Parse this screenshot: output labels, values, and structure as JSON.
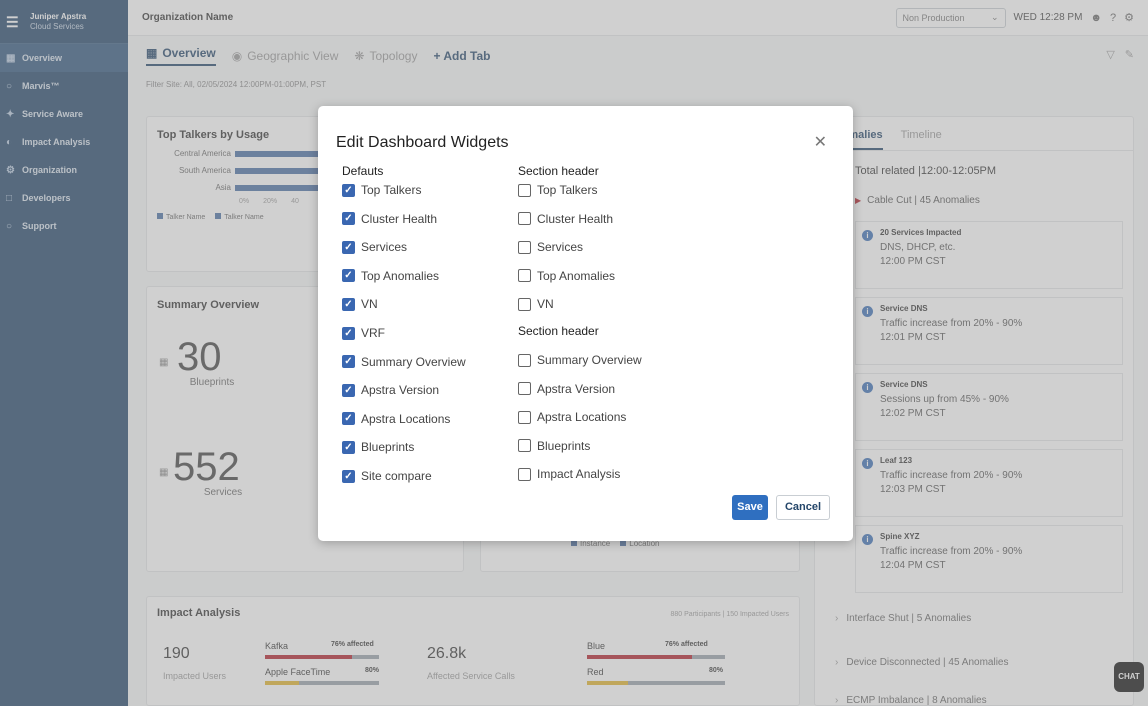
{
  "app": {
    "brand_line1": "Juniper Apstra",
    "brand_line2": "Cloud Services",
    "org_name": "Organization Name",
    "environment": "Non Production",
    "clock": "WED 12:28 PM"
  },
  "sidebar": {
    "items": [
      {
        "label": "Overview",
        "icon": "grid-icon"
      },
      {
        "label": "Marvis™",
        "icon": "marvis-icon"
      },
      {
        "label": "Service Aware",
        "icon": "service-icon"
      },
      {
        "label": "Impact Analysis",
        "icon": "impact-icon"
      },
      {
        "label": "Organization",
        "icon": "gear-icon"
      },
      {
        "label": "Developers",
        "icon": "code-icon"
      },
      {
        "label": "Support",
        "icon": "support-icon"
      }
    ]
  },
  "tabs": {
    "overview": "Overview",
    "geographic": "Geographic View",
    "topology": "Topology",
    "add": "+ Add Tab"
  },
  "filter_line": "Filter Site: All, 02/05/2024 12:00PM-01:00PM, PST",
  "talkers": {
    "title": "Top Talkers by Usage",
    "rows": [
      "Central America",
      "South America",
      "Asia"
    ],
    "ticks": [
      "0%",
      "20%",
      "40"
    ],
    "legend": [
      "Talker Name",
      "Talker Name"
    ]
  },
  "summary": {
    "title": "Summary Overview",
    "stat1_value": "30",
    "stat1_label": "Blueprints",
    "stat2_value": "552",
    "stat2_label": "Services"
  },
  "location_legend": [
    "Instance",
    "Location"
  ],
  "impact": {
    "title": "Impact Analysis",
    "meta": "880 Participants | 150 Impacted Users",
    "users_value": "190",
    "users_label": "Impacted Users",
    "calls_value": "26.8k",
    "calls_label": "Affected Service Calls",
    "bars": [
      {
        "name": "Kafka",
        "pct": "76% affected",
        "fill": 0.76
      },
      {
        "name": "Apple FaceTime",
        "pct": "80%",
        "fill": 0.3
      },
      {
        "name": "Blue",
        "pct": "76% affected",
        "fill": 0.76
      },
      {
        "name": "Red",
        "pct": "80%",
        "fill": 0.3
      }
    ]
  },
  "anomalies": {
    "tab_active": "Anomalies",
    "tab_other": "Timeline",
    "total": "Total related |12:00-12:05PM",
    "group": "Cable Cut | 45 Anomalies",
    "items": [
      {
        "title": "20 Services Impacted",
        "desc": "DNS, DHCP, etc.",
        "time": "12:00 PM CST"
      },
      {
        "title": "Service DNS",
        "desc": "Traffic increase from 20% - 90%",
        "time": "12:01 PM CST"
      },
      {
        "title": "Service DNS",
        "desc": "Sessions up from 45% - 90%",
        "time": "12:02 PM CST"
      },
      {
        "title": "Leaf 123",
        "desc": "Traffic increase from 20% - 90%",
        "time": "12:03 PM CST"
      },
      {
        "title": "Spine XYZ",
        "desc": "Traffic increase from 20% - 90%",
        "time": "12:04 PM CST"
      }
    ],
    "collapsed": [
      "Interface Shut | 5 Anomalies",
      "Device Disconnected | 45 Anomalies",
      "ECMP Imbalance | 8 Anomalies"
    ]
  },
  "modal": {
    "title": "Edit Dashboard Widgets",
    "col1_header": "Defauts",
    "col1_items": [
      {
        "label": "Top Talkers",
        "checked": true
      },
      {
        "label": "Cluster Health",
        "checked": true
      },
      {
        "label": "Services",
        "checked": true
      },
      {
        "label": "Top Anomalies",
        "checked": true
      },
      {
        "label": "VN",
        "checked": true
      },
      {
        "label": "VRF",
        "checked": true
      },
      {
        "label": "Summary Overview",
        "checked": true
      },
      {
        "label": "Apstra Version",
        "checked": true
      },
      {
        "label": "Apstra Locations",
        "checked": true
      },
      {
        "label": "Blueprints",
        "checked": true
      },
      {
        "label": "Site compare",
        "checked": true
      }
    ],
    "col2_header": "Section header",
    "col2_items": [
      {
        "label": "Top Talkers",
        "checked": false
      },
      {
        "label": "Cluster Health",
        "checked": false
      },
      {
        "label": "Services",
        "checked": false
      },
      {
        "label": "Top Anomalies",
        "checked": false
      },
      {
        "label": "VN",
        "checked": false
      }
    ],
    "col2b_header": "Section header",
    "col2b_items": [
      {
        "label": "Summary Overview",
        "checked": false
      },
      {
        "label": "Apstra Version",
        "checked": false
      },
      {
        "label": "Apstra Locations",
        "checked": false
      },
      {
        "label": "Blueprints",
        "checked": false
      },
      {
        "label": "Impact Analysis",
        "checked": false
      }
    ],
    "save": "Save",
    "cancel": "Cancel",
    "check_glyph": "✓",
    "accent": "#3a67b1"
  },
  "chat_button": "CHAT"
}
